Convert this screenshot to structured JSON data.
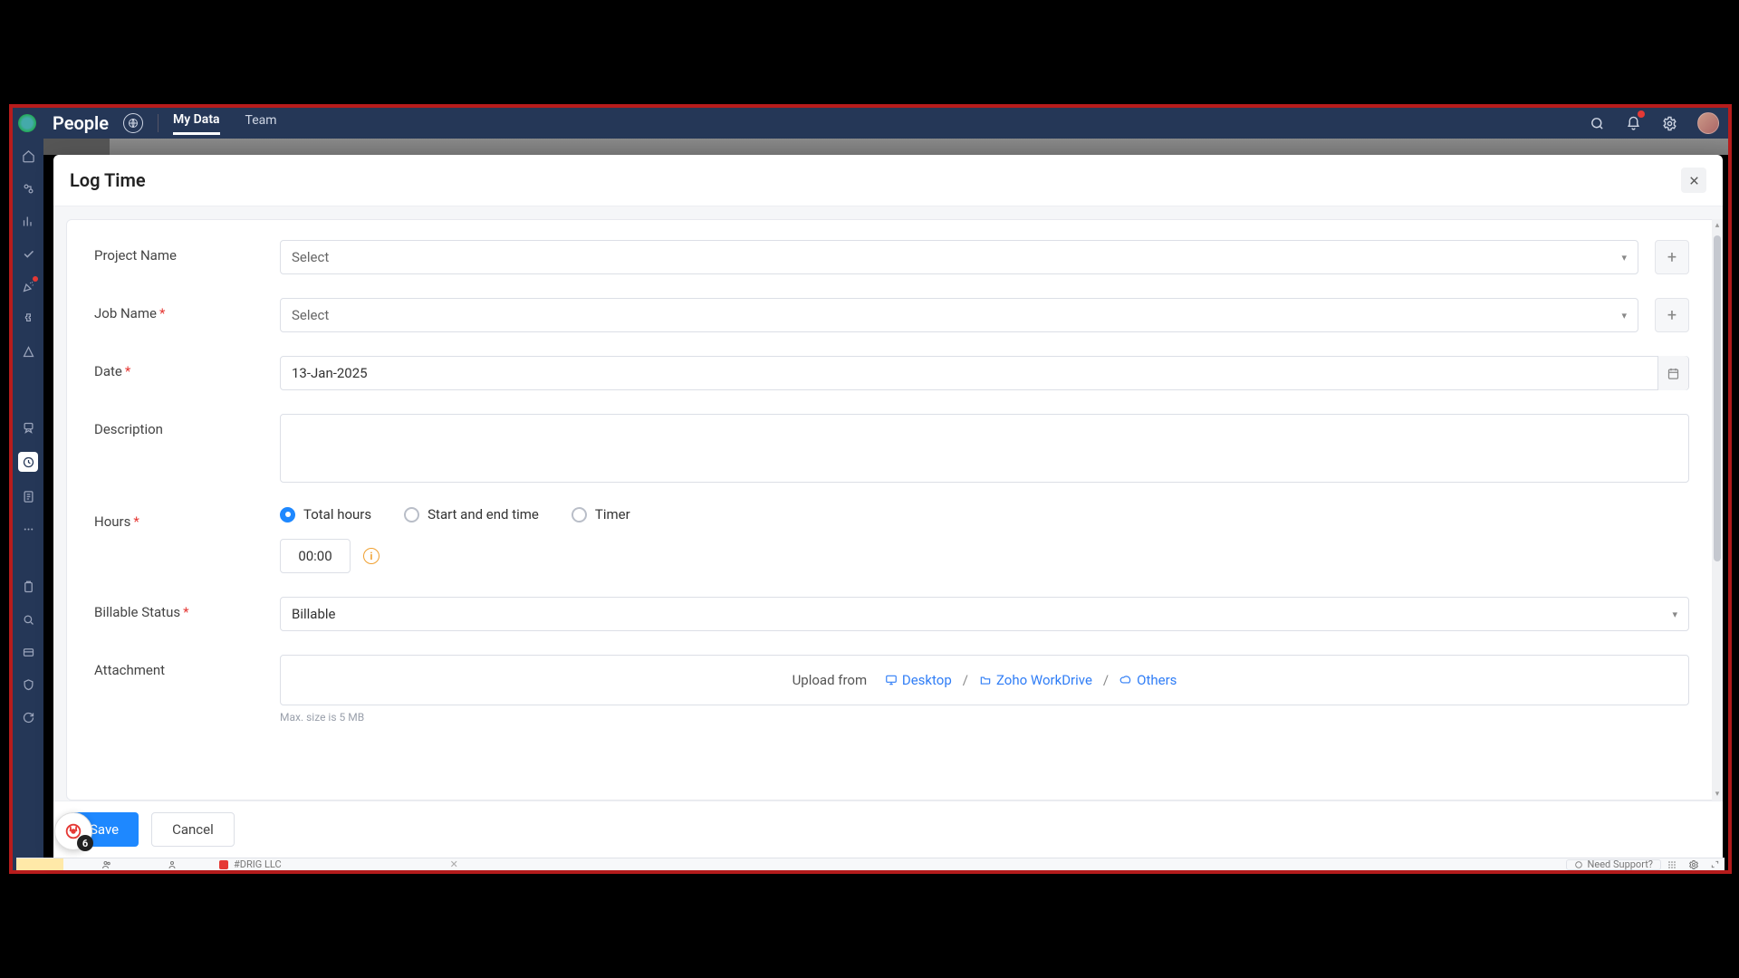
{
  "topbar": {
    "brand": "People",
    "tabs": {
      "mydata": "My Data",
      "team": "Team"
    }
  },
  "modal": {
    "title": "Log Time",
    "labels": {
      "project": "Project Name",
      "job": "Job Name",
      "date": "Date",
      "description": "Description",
      "hours": "Hours",
      "billable": "Billable Status",
      "attachment": "Attachment"
    },
    "project": {
      "placeholder": "Select"
    },
    "job": {
      "placeholder": "Select"
    },
    "date": {
      "value": "13-Jan-2025"
    },
    "hours": {
      "options": {
        "total": "Total hours",
        "startend": "Start and end time",
        "timer": "Timer"
      },
      "value": "00:00"
    },
    "billable": {
      "value": "Billable"
    },
    "upload": {
      "prefix": "Upload from",
      "desktop": "Desktop",
      "workdrive": "Zoho WorkDrive",
      "others": "Others",
      "hint": "Max. size is 5 MB"
    },
    "buttons": {
      "save": "Save",
      "cancel": "Cancel"
    }
  },
  "chat": {
    "badge": "6"
  },
  "bottombar": {
    "channel": "#DRIG LLC",
    "support": "Need Support?"
  }
}
